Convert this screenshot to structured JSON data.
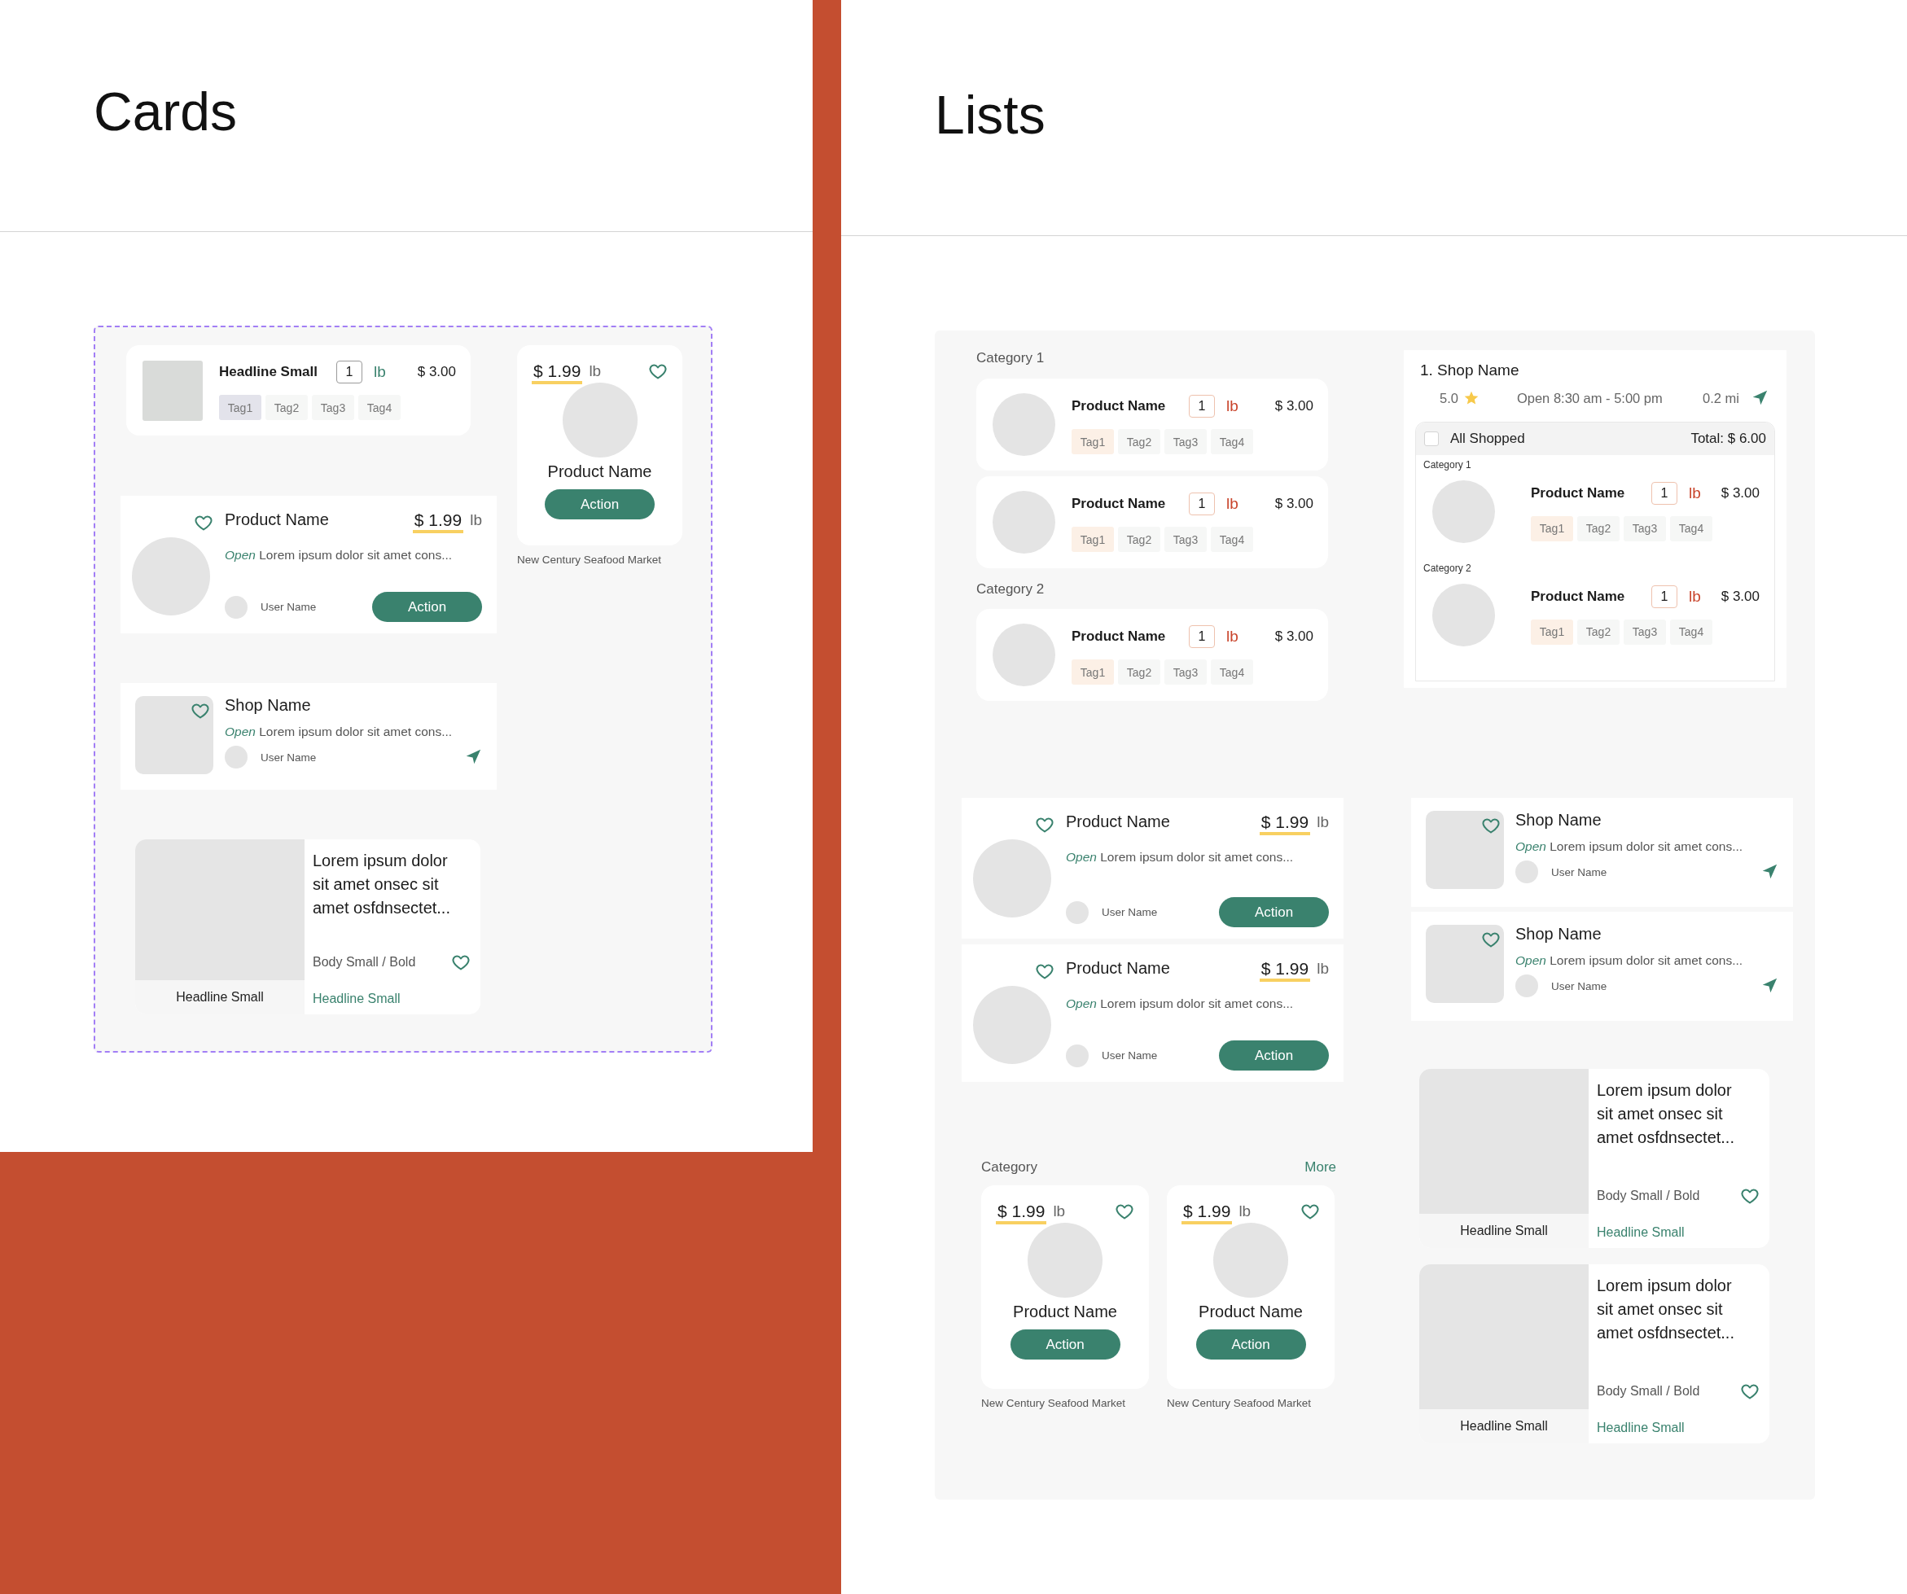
{
  "cards_page": {
    "title": "Cards",
    "items": [
      {
        "kind": "cart_row",
        "name": "Headline Small",
        "quantity": "1",
        "unit": "lb",
        "price": "$ 3.00",
        "tags": [
          {
            "label": "Tag1",
            "selected": true
          },
          {
            "label": "Tag2",
            "selected": false
          },
          {
            "label": "Tag3",
            "selected": false
          },
          {
            "label": "Tag4",
            "selected": false
          }
        ]
      },
      {
        "kind": "product_tile",
        "price": "$ 1.99",
        "unit": "lb",
        "name": "Product Name",
        "action": "Action",
        "caption": "New Century Seafood Market"
      },
      {
        "kind": "product_wide",
        "name": "Product Name",
        "price": "$ 1.99",
        "unit": "lb",
        "status": "Open",
        "description": "Lorem ipsum dolor sit amet cons...",
        "user": "User Name",
        "action": "Action"
      },
      {
        "kind": "shop_row",
        "name": "Shop Name",
        "status": "Open",
        "description": "Lorem ipsum dolor sit amet cons...",
        "user": "User Name"
      },
      {
        "kind": "article",
        "image_caption": "Headline Small",
        "title": "Lorem ipsum dolor sit amet onsec sit amet osfdnsectet...",
        "meta": "Body Small / Bold",
        "link": "Headline Small"
      }
    ]
  },
  "lists_page": {
    "title": "Lists",
    "items": [
      {
        "kind": "label",
        "text": "Category 1"
      },
      {
        "kind": "cart_row",
        "name": "Product Name",
        "quantity": "1",
        "unit": "lb",
        "price": "$ 3.00",
        "tags": [
          {
            "label": "Tag1",
            "selected": true
          },
          {
            "label": "Tag2",
            "selected": false
          },
          {
            "label": "Tag3",
            "selected": false
          },
          {
            "label": "Tag4",
            "selected": false
          }
        ]
      },
      {
        "kind": "cart_row",
        "name": "Product Name",
        "quantity": "1",
        "unit": "lb",
        "price": "$ 3.00",
        "tags": [
          {
            "label": "Tag1",
            "selected": true
          },
          {
            "label": "Tag2",
            "selected": false
          },
          {
            "label": "Tag3",
            "selected": false
          },
          {
            "label": "Tag4",
            "selected": false
          }
        ]
      },
      {
        "kind": "label",
        "text": "Category 2"
      },
      {
        "kind": "cart_row",
        "name": "Product Name",
        "quantity": "1",
        "unit": "lb",
        "price": "$ 3.00",
        "tags": [
          {
            "label": "Tag1",
            "selected": true
          },
          {
            "label": "Tag2",
            "selected": false
          },
          {
            "label": "Tag3",
            "selected": false
          },
          {
            "label": "Tag4",
            "selected": false
          }
        ]
      },
      {
        "kind": "shop_group",
        "index": "1.",
        "name": "Shop Name",
        "rating": "5.0",
        "hours": "Open 8:30 am - 5:00 pm",
        "distance": "0.2 mi",
        "all_shopped": {
          "label": "All Shopped",
          "checked": false
        },
        "total": "Total: $ 6.00",
        "categories": [
          {
            "name": "Category 1",
            "rows": [
              {
                "name": "Product Name",
                "quantity": "1",
                "unit": "lb",
                "price": "$ 3.00",
                "tags": [
                  {
                    "label": "Tag1",
                    "selected": true
                  },
                  {
                    "label": "Tag2",
                    "selected": false
                  },
                  {
                    "label": "Tag3",
                    "selected": false
                  },
                  {
                    "label": "Tag4",
                    "selected": false
                  }
                ]
              }
            ]
          },
          {
            "name": "Category 2",
            "rows": [
              {
                "name": "Product Name",
                "quantity": "1",
                "unit": "lb",
                "price": "$ 3.00",
                "tags": [
                  {
                    "label": "Tag1",
                    "selected": true
                  },
                  {
                    "label": "Tag2",
                    "selected": false
                  },
                  {
                    "label": "Tag3",
                    "selected": false
                  },
                  {
                    "label": "Tag4",
                    "selected": false
                  }
                ]
              }
            ]
          }
        ]
      },
      {
        "kind": "product_wide",
        "name": "Product Name",
        "price": "$ 1.99",
        "unit": "lb",
        "status": "Open",
        "description": "Lorem ipsum dolor sit amet cons...",
        "user": "User Name",
        "action": "Action"
      },
      {
        "kind": "product_wide",
        "name": "Product Name",
        "price": "$ 1.99",
        "unit": "lb",
        "status": "Open",
        "description": "Lorem ipsum dolor sit amet cons...",
        "user": "User Name",
        "action": "Action"
      },
      {
        "kind": "shop_row",
        "name": "Shop Name",
        "status": "Open",
        "description": "Lorem ipsum dolor sit amet cons...",
        "user": "User Name"
      },
      {
        "kind": "shop_row",
        "name": "Shop Name",
        "status": "Open",
        "description": "Lorem ipsum dolor sit amet cons...",
        "user": "User Name"
      },
      {
        "kind": "section_header",
        "title": "Category",
        "more": "More"
      },
      {
        "kind": "product_tile",
        "price": "$ 1.99",
        "unit": "lb",
        "name": "Product Name",
        "action": "Action",
        "caption": "New Century Seafood Market"
      },
      {
        "kind": "product_tile",
        "price": "$ 1.99",
        "unit": "lb",
        "name": "Product Name",
        "action": "Action",
        "caption": "New Century Seafood Market"
      },
      {
        "kind": "article",
        "image_caption": "Headline Small",
        "title": "Lorem ipsum dolor sit amet onsec sit amet osfdnsectet...",
        "meta": "Body Small / Bold",
        "link": "Headline Small"
      },
      {
        "kind": "article",
        "image_caption": "Headline Small",
        "title": "Lorem ipsum dolor sit amet onsec sit amet osfdnsectet...",
        "meta": "Body Small / Bold",
        "link": "Headline Small"
      }
    ]
  }
}
